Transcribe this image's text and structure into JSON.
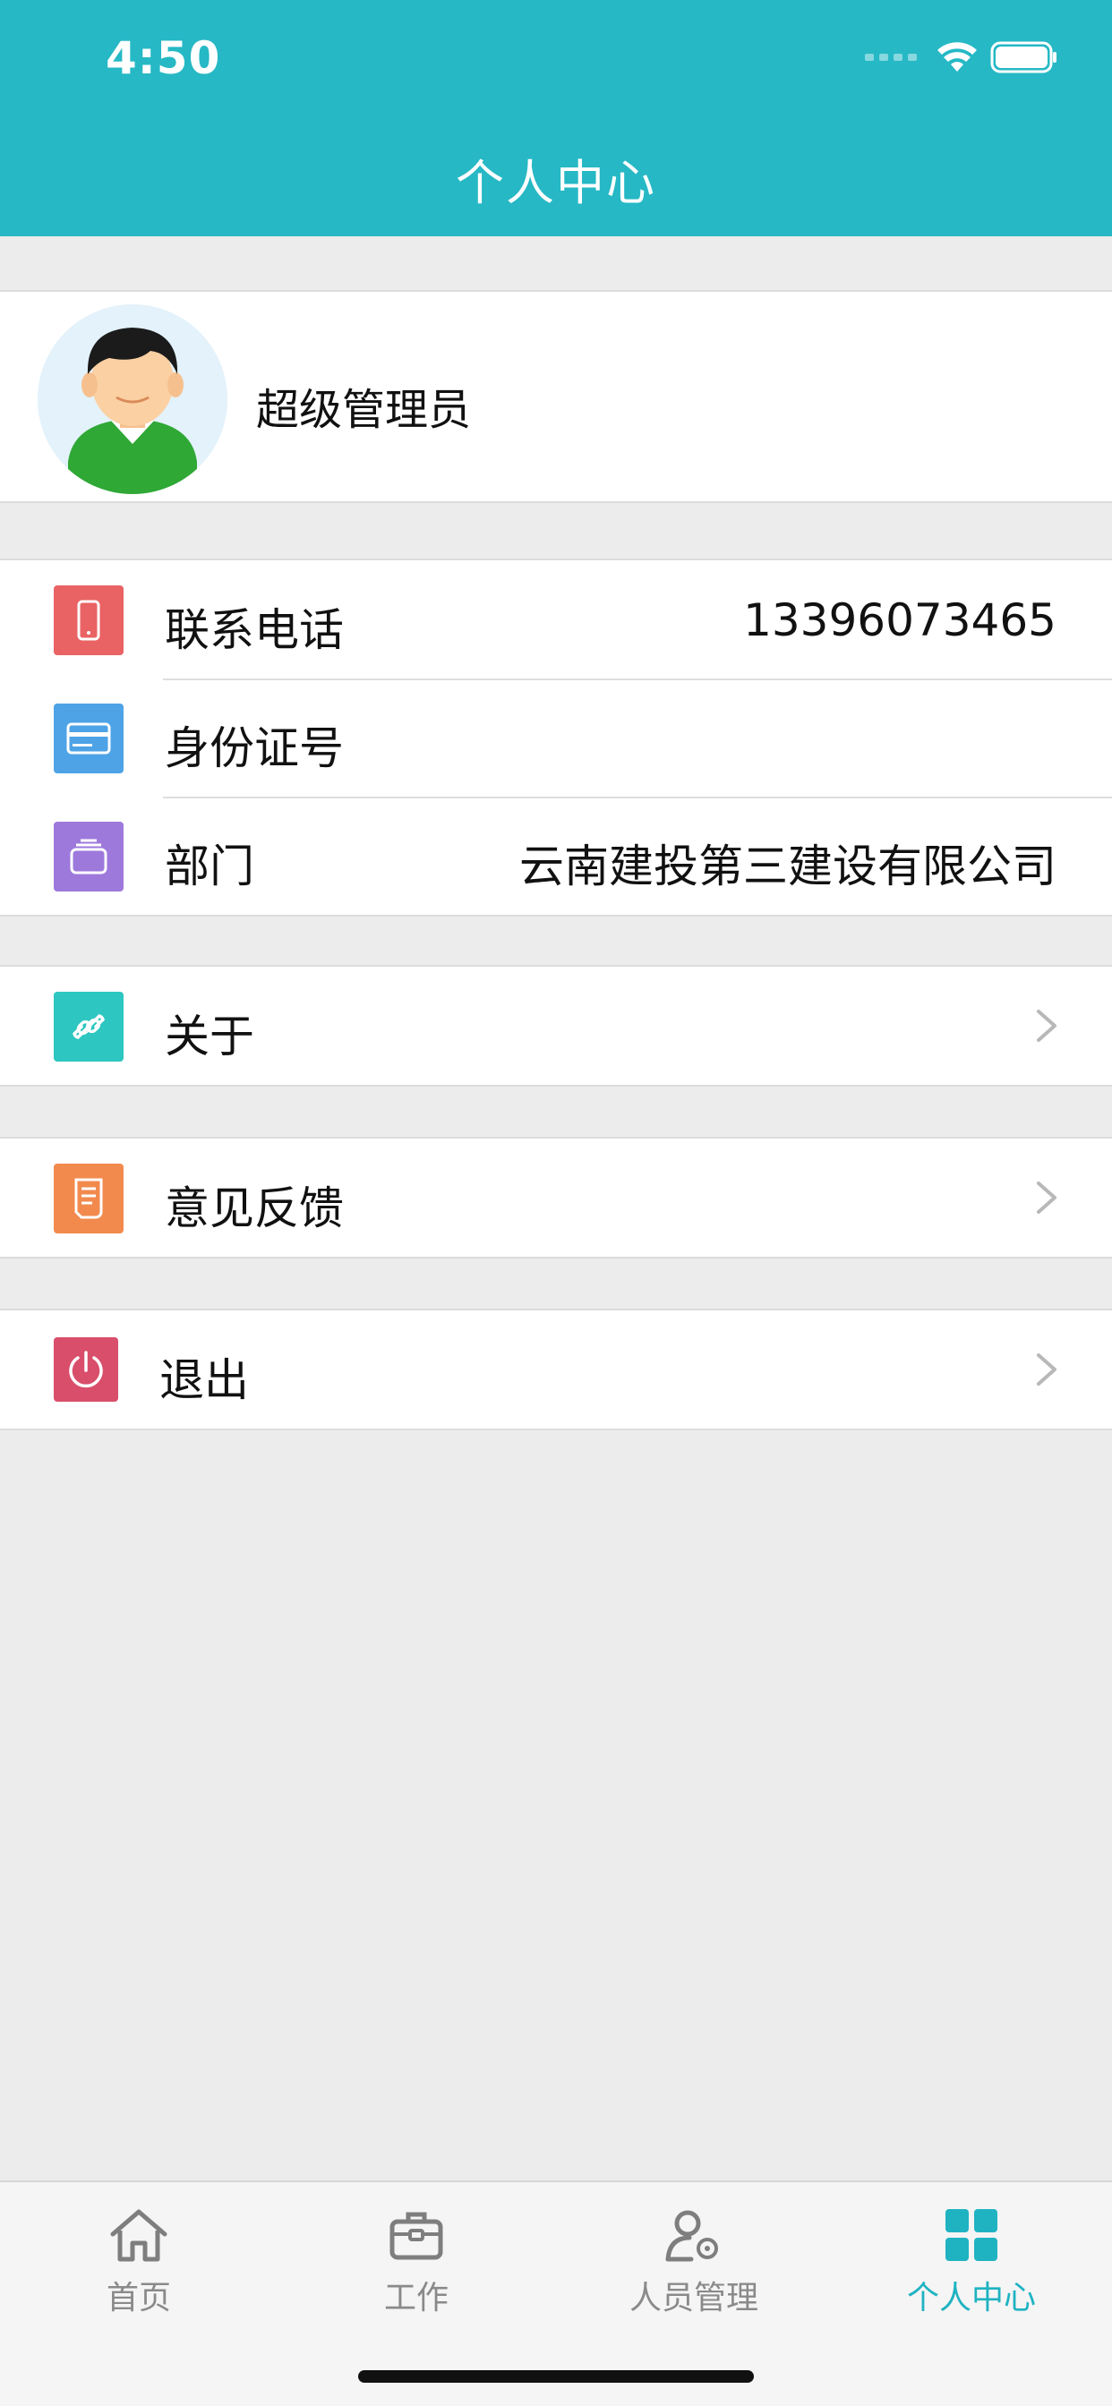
{
  "status_bar": {
    "time": "4:50"
  },
  "header": {
    "title": "个人中心"
  },
  "profile": {
    "name": "超级管理员"
  },
  "info_rows": [
    {
      "label": "联系电话",
      "value": "13396073465",
      "icon": "phone-icon",
      "color": "#ea6364"
    },
    {
      "label": "身份证号",
      "value": "",
      "icon": "id-card-icon",
      "color": "#4da3e6"
    },
    {
      "label": "部门",
      "value": "云南建投第三建设有限公司",
      "icon": "department-icon",
      "color": "#9e79dc"
    }
  ],
  "menu": {
    "about": {
      "label": "关于",
      "icon": "link-icon",
      "color": "#2dc6c0"
    },
    "feedback": {
      "label": "意见反馈",
      "icon": "feedback-icon",
      "color": "#f28a4e"
    },
    "logout": {
      "label": "退出",
      "icon": "power-icon",
      "color": "#d94e6b"
    }
  },
  "tabbar": {
    "tabs": [
      {
        "label": "首页",
        "icon": "home-icon",
        "active": false
      },
      {
        "label": "工作",
        "icon": "briefcase-icon",
        "active": false
      },
      {
        "label": "人员管理",
        "icon": "user-settings-icon",
        "active": false
      },
      {
        "label": "个人中心",
        "icon": "grid-icon",
        "active": true
      }
    ],
    "active_color": "#1fb3c2",
    "inactive_color": "#8a8a8a"
  },
  "colors": {
    "header": "#26b8c5",
    "background": "#ececec"
  }
}
